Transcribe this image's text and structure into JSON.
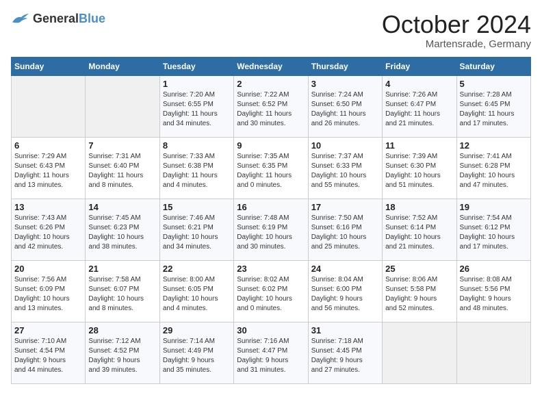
{
  "logo": {
    "general": "General",
    "blue": "Blue"
  },
  "title": "October 2024",
  "location": "Martensrade, Germany",
  "days_header": [
    "Sunday",
    "Monday",
    "Tuesday",
    "Wednesday",
    "Thursday",
    "Friday",
    "Saturday"
  ],
  "weeks": [
    [
      {
        "day": "",
        "info": ""
      },
      {
        "day": "",
        "info": ""
      },
      {
        "day": "1",
        "info": "Sunrise: 7:20 AM\nSunset: 6:55 PM\nDaylight: 11 hours\nand 34 minutes."
      },
      {
        "day": "2",
        "info": "Sunrise: 7:22 AM\nSunset: 6:52 PM\nDaylight: 11 hours\nand 30 minutes."
      },
      {
        "day": "3",
        "info": "Sunrise: 7:24 AM\nSunset: 6:50 PM\nDaylight: 11 hours\nand 26 minutes."
      },
      {
        "day": "4",
        "info": "Sunrise: 7:26 AM\nSunset: 6:47 PM\nDaylight: 11 hours\nand 21 minutes."
      },
      {
        "day": "5",
        "info": "Sunrise: 7:28 AM\nSunset: 6:45 PM\nDaylight: 11 hours\nand 17 minutes."
      }
    ],
    [
      {
        "day": "6",
        "info": "Sunrise: 7:29 AM\nSunset: 6:43 PM\nDaylight: 11 hours\nand 13 minutes."
      },
      {
        "day": "7",
        "info": "Sunrise: 7:31 AM\nSunset: 6:40 PM\nDaylight: 11 hours\nand 8 minutes."
      },
      {
        "day": "8",
        "info": "Sunrise: 7:33 AM\nSunset: 6:38 PM\nDaylight: 11 hours\nand 4 minutes."
      },
      {
        "day": "9",
        "info": "Sunrise: 7:35 AM\nSunset: 6:35 PM\nDaylight: 11 hours\nand 0 minutes."
      },
      {
        "day": "10",
        "info": "Sunrise: 7:37 AM\nSunset: 6:33 PM\nDaylight: 10 hours\nand 55 minutes."
      },
      {
        "day": "11",
        "info": "Sunrise: 7:39 AM\nSunset: 6:30 PM\nDaylight: 10 hours\nand 51 minutes."
      },
      {
        "day": "12",
        "info": "Sunrise: 7:41 AM\nSunset: 6:28 PM\nDaylight: 10 hours\nand 47 minutes."
      }
    ],
    [
      {
        "day": "13",
        "info": "Sunrise: 7:43 AM\nSunset: 6:26 PM\nDaylight: 10 hours\nand 42 minutes."
      },
      {
        "day": "14",
        "info": "Sunrise: 7:45 AM\nSunset: 6:23 PM\nDaylight: 10 hours\nand 38 minutes."
      },
      {
        "day": "15",
        "info": "Sunrise: 7:46 AM\nSunset: 6:21 PM\nDaylight: 10 hours\nand 34 minutes."
      },
      {
        "day": "16",
        "info": "Sunrise: 7:48 AM\nSunset: 6:19 PM\nDaylight: 10 hours\nand 30 minutes."
      },
      {
        "day": "17",
        "info": "Sunrise: 7:50 AM\nSunset: 6:16 PM\nDaylight: 10 hours\nand 25 minutes."
      },
      {
        "day": "18",
        "info": "Sunrise: 7:52 AM\nSunset: 6:14 PM\nDaylight: 10 hours\nand 21 minutes."
      },
      {
        "day": "19",
        "info": "Sunrise: 7:54 AM\nSunset: 6:12 PM\nDaylight: 10 hours\nand 17 minutes."
      }
    ],
    [
      {
        "day": "20",
        "info": "Sunrise: 7:56 AM\nSunset: 6:09 PM\nDaylight: 10 hours\nand 13 minutes."
      },
      {
        "day": "21",
        "info": "Sunrise: 7:58 AM\nSunset: 6:07 PM\nDaylight: 10 hours\nand 8 minutes."
      },
      {
        "day": "22",
        "info": "Sunrise: 8:00 AM\nSunset: 6:05 PM\nDaylight: 10 hours\nand 4 minutes."
      },
      {
        "day": "23",
        "info": "Sunrise: 8:02 AM\nSunset: 6:02 PM\nDaylight: 10 hours\nand 0 minutes."
      },
      {
        "day": "24",
        "info": "Sunrise: 8:04 AM\nSunset: 6:00 PM\nDaylight: 9 hours\nand 56 minutes."
      },
      {
        "day": "25",
        "info": "Sunrise: 8:06 AM\nSunset: 5:58 PM\nDaylight: 9 hours\nand 52 minutes."
      },
      {
        "day": "26",
        "info": "Sunrise: 8:08 AM\nSunset: 5:56 PM\nDaylight: 9 hours\nand 48 minutes."
      }
    ],
    [
      {
        "day": "27",
        "info": "Sunrise: 7:10 AM\nSunset: 4:54 PM\nDaylight: 9 hours\nand 44 minutes."
      },
      {
        "day": "28",
        "info": "Sunrise: 7:12 AM\nSunset: 4:52 PM\nDaylight: 9 hours\nand 39 minutes."
      },
      {
        "day": "29",
        "info": "Sunrise: 7:14 AM\nSunset: 4:49 PM\nDaylight: 9 hours\nand 35 minutes."
      },
      {
        "day": "30",
        "info": "Sunrise: 7:16 AM\nSunset: 4:47 PM\nDaylight: 9 hours\nand 31 minutes."
      },
      {
        "day": "31",
        "info": "Sunrise: 7:18 AM\nSunset: 4:45 PM\nDaylight: 9 hours\nand 27 minutes."
      },
      {
        "day": "",
        "info": ""
      },
      {
        "day": "",
        "info": ""
      }
    ]
  ]
}
